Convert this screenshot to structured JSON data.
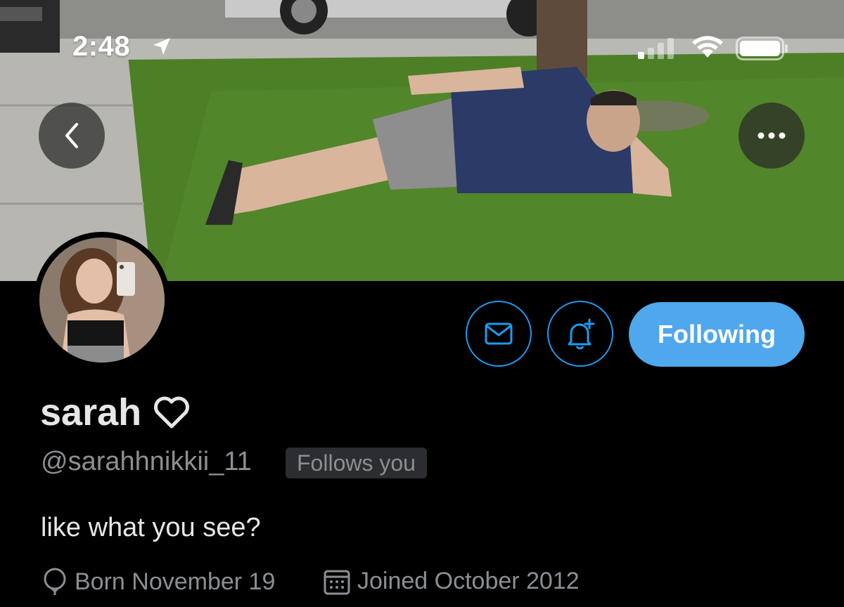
{
  "status_bar": {
    "time": "2:48",
    "icons": [
      "location-arrow-icon",
      "cellular-signal-icon",
      "wifi-icon",
      "battery-icon"
    ]
  },
  "banner": {
    "description_icon": "banner-photo"
  },
  "nav": {
    "back_icon": "chevron-left-icon",
    "more_icon": "more-dots-icon"
  },
  "profile": {
    "display_name": "sarah",
    "name_emoji_icon": "heart-outline-icon",
    "handle": "@sarahhnikkii_11",
    "follows_you": "Follows you",
    "bio": "like what you see?",
    "birthday": "Born November 19",
    "joined": "Joined October 2012"
  },
  "actions": {
    "message_icon": "envelope-icon",
    "notify_icon": "bell-plus-icon",
    "following_label": "Following"
  },
  "colors": {
    "accent": "#1d9bf0",
    "following_bg": "#4fa7ec",
    "background": "#000000",
    "secondary_text": "#8b8f94"
  }
}
